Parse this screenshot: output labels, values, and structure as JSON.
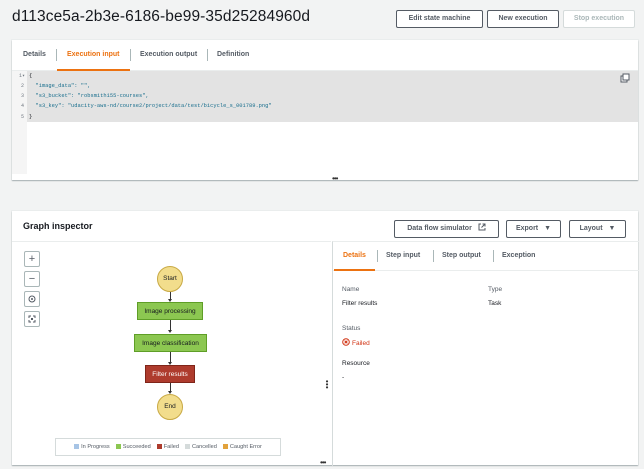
{
  "header": {
    "execution_id": "d113ce5a-2b3e-6186-be99-35d25284960d",
    "edit_label": "Edit state machine",
    "new_label": "New execution",
    "stop_label": "Stop execution"
  },
  "details_tabs": [
    "Details",
    "Execution input",
    "Execution output",
    "Definition"
  ],
  "active_details_tab": "Execution input",
  "editor": {
    "line_numbers": [
      "1",
      "2",
      "3",
      "4",
      "5"
    ],
    "lines": [
      "{",
      "  \"image_data\": \"\",",
      "  \"s3_bucket\": \"robsmith155-courses\",",
      "  \"s3_key\": \"udacity-aws-nd/course2/project/data/test/bicycle_s_001789.png\"",
      "}"
    ]
  },
  "graph": {
    "title": "Graph inspector",
    "data_flow_label": "Data flow simulator",
    "export_label": "Export",
    "layout_label": "Layout",
    "nodes": {
      "start": "Start",
      "n1": "Image processing",
      "n2": "Image classification",
      "n3": "Filter results",
      "end": "End"
    },
    "legend": [
      {
        "label": "In Progress",
        "color": "#a7c4e5"
      },
      {
        "label": "Succeeded",
        "color": "#8cc751"
      },
      {
        "label": "Failed",
        "color": "#ae3b2d"
      },
      {
        "label": "Cancelled",
        "color": "#d5dbdb"
      },
      {
        "label": "Caught Error",
        "color": "#e2a23b"
      }
    ]
  },
  "step_tabs": [
    "Details",
    "Step input",
    "Step output",
    "Exception"
  ],
  "active_step_tab": "Details",
  "step_details": {
    "name_label": "Name",
    "name_value": "Filter results",
    "type_label": "Type",
    "type_value": "Task",
    "status_label": "Status",
    "status_value": "Failed",
    "resource_label": "Resource",
    "resource_value": "-"
  }
}
